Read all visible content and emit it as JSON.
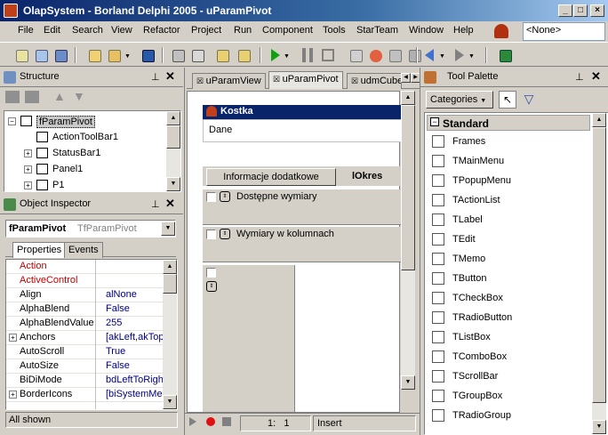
{
  "window": {
    "title": "OlapSystem - Borland Delphi 2005 - uParamPivot"
  },
  "menu": [
    "File",
    "Edit",
    "Search",
    "View",
    "Refactor",
    "Project",
    "Run",
    "Component",
    "Tools",
    "StarTeam",
    "Window",
    "Help"
  ],
  "toolbar": {
    "config_combo": "<None>"
  },
  "structure": {
    "title": "Structure",
    "tree": [
      {
        "label": "fParamPivot",
        "expander": "−",
        "level": 0,
        "selected": true
      },
      {
        "label": "ActionToolBar1",
        "expander": "",
        "level": 1
      },
      {
        "label": "StatusBar1",
        "expander": "+",
        "level": 1
      },
      {
        "label": "Panel1",
        "expander": "+",
        "level": 1
      },
      {
        "label": "P1",
        "expander": "+",
        "level": 1
      }
    ]
  },
  "inspector": {
    "title": "Object Inspector",
    "object_name": "fParamPivot",
    "object_type": "TfParamPivot",
    "tabs": [
      "Properties",
      "Events"
    ],
    "rows": [
      {
        "key": "Action",
        "value": "",
        "expander": "",
        "red": true
      },
      {
        "key": "ActiveControl",
        "value": "",
        "expander": "",
        "red": true
      },
      {
        "key": "Align",
        "value": "alNone",
        "expander": ""
      },
      {
        "key": "AlphaBlend",
        "value": "False",
        "expander": ""
      },
      {
        "key": "AlphaBlendValue",
        "value": "255",
        "expander": ""
      },
      {
        "key": "Anchors",
        "value": "[akLeft,akTop]",
        "expander": "+"
      },
      {
        "key": "AutoScroll",
        "value": "True",
        "expander": ""
      },
      {
        "key": "AutoSize",
        "value": "False",
        "expander": ""
      },
      {
        "key": "BiDiMode",
        "value": "bdLeftToRight",
        "expander": ""
      },
      {
        "key": "BorderIcons",
        "value": "[biSystemMenu",
        "expander": "+"
      }
    ],
    "status": "All shown"
  },
  "editor": {
    "tabs": [
      "uParamView",
      "uParamPivot",
      "udmCube"
    ],
    "active_tab": 1,
    "form": {
      "kostka_title": "Kostka",
      "dane_label": "Dane",
      "info_button": "Informacje dodatkowe",
      "okres_label": "lOkres",
      "dim_available": "Dostępne wymiary",
      "dim_columns": "Wymiary w kolumnach"
    },
    "status": {
      "position": "1:   1",
      "mode": "Insert"
    }
  },
  "palette": {
    "title": "Tool Palette",
    "categories_label": "Categories",
    "group": "Standard",
    "items": [
      "Frames",
      "TMainMenu",
      "TPopupMenu",
      "TActionList",
      "TLabel",
      "TEdit",
      "TMemo",
      "TButton",
      "TCheckBox",
      "TRadioButton",
      "TListBox",
      "TComboBox",
      "TScrollBar",
      "TGroupBox",
      "TRadioGroup"
    ]
  }
}
